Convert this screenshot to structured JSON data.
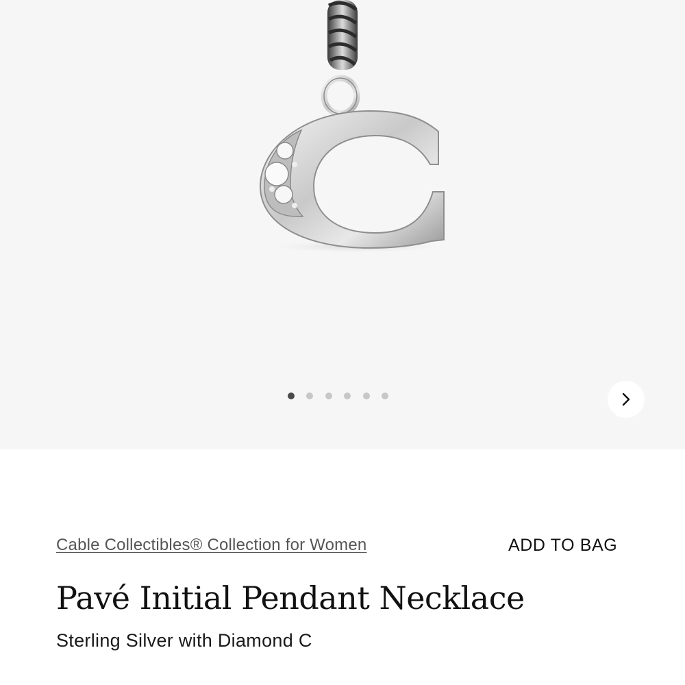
{
  "gallery": {
    "image_icon": "pendant-c-initial-image",
    "dots_total": 6,
    "dots_active_index": 0,
    "next_icon": "chevron-right-icon"
  },
  "product": {
    "collection_link": "Cable Collectibles® Collection for Women",
    "add_to_bag_label": "ADD TO BAG",
    "title": "Pavé Initial Pendant Necklace",
    "subtitle": "Sterling Silver with Diamond C"
  },
  "colors": {
    "gallery_bg": "#f6f6f6",
    "dot_active": "#4a4a4a",
    "dot_inactive": "#c7c7c7",
    "text": "#111111",
    "link_text": "#555555"
  }
}
